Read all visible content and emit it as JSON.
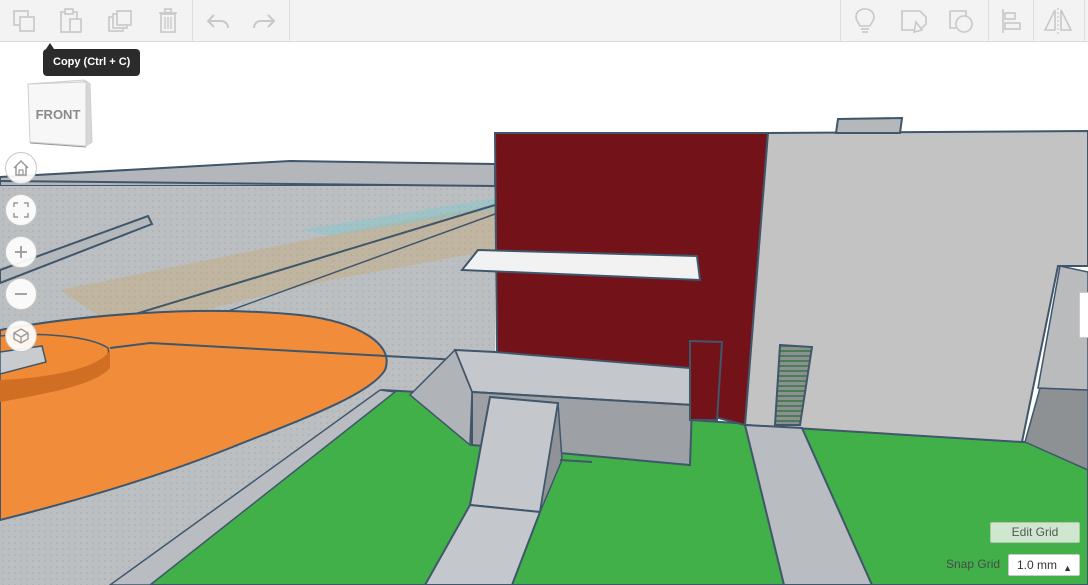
{
  "toolbar": {
    "tools": [
      {
        "name": "copy-icon"
      },
      {
        "name": "paste-icon"
      },
      {
        "name": "duplicate-icon"
      },
      {
        "name": "delete-icon"
      },
      {
        "name": "undo-icon"
      },
      {
        "name": "redo-icon"
      },
      {
        "name": "lightbulb-icon"
      },
      {
        "name": "workplane-icon"
      },
      {
        "name": "ruler-icon"
      },
      {
        "name": "align-icon"
      },
      {
        "name": "mirror-icon"
      }
    ]
  },
  "tooltip": {
    "text": "Copy (Ctrl + C)"
  },
  "view_cube": {
    "label": "FRONT"
  },
  "view_controls": [
    "home-icon",
    "fit-view-icon",
    "zoom-in-icon",
    "zoom-out-icon",
    "projection-icon"
  ],
  "grid": {
    "edit_label": "Edit Grid",
    "snap_label": "Snap Grid",
    "snap_value": "1.0 mm"
  },
  "colors": {
    "floor": "#b9bdc1",
    "grass": "#41b049",
    "orange": "#f18c3a",
    "red_wall": "#741219",
    "grey_wall": "#c3c3c3",
    "outline": "#3f566b"
  }
}
